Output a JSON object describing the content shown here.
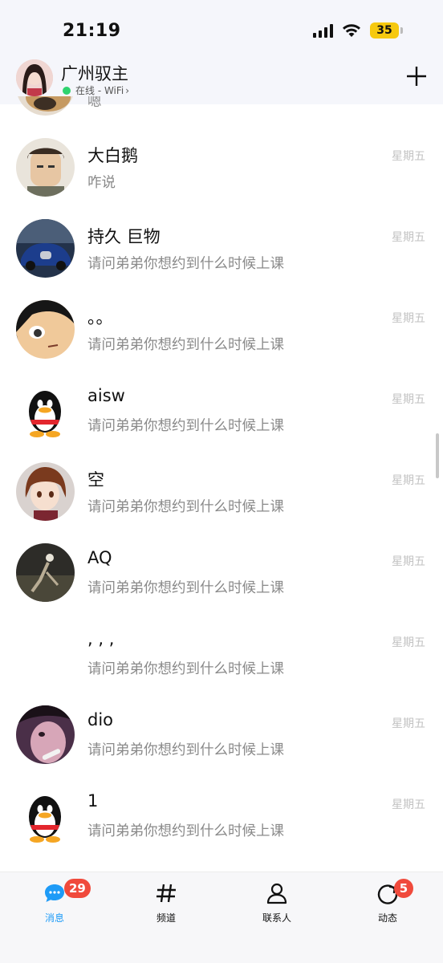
{
  "status_bar": {
    "time": "21:19",
    "battery": "35"
  },
  "header": {
    "name": "广州驭主",
    "status": "在线 - WiFi",
    "status_chevron": "›"
  },
  "conversations": [
    {
      "name": "",
      "message": "嗯",
      "time": ""
    },
    {
      "name": "大白鹅",
      "message": "咋说",
      "time": "星期五"
    },
    {
      "name": "持久 巨物",
      "message": "请问弟弟你想约到什么时候上课",
      "time": "星期五"
    },
    {
      "name": "。。",
      "message": "请问弟弟你想约到什么时候上课",
      "time": "星期五"
    },
    {
      "name": "aisw",
      "message": "请问弟弟你想约到什么时候上课",
      "time": "星期五"
    },
    {
      "name": "空",
      "message": "请问弟弟你想约到什么时候上课",
      "time": "星期五"
    },
    {
      "name": "AQ",
      "message": "请问弟弟你想约到什么时候上课",
      "time": "星期五"
    },
    {
      "name": ", , ,",
      "message": "请问弟弟你想约到什么时候上课",
      "time": "星期五"
    },
    {
      "name": "dio",
      "message": "请问弟弟你想约到什么时候上课",
      "time": "星期五"
    },
    {
      "name": "1",
      "message": "请问弟弟你想约到什么时候上课",
      "time": "星期五"
    }
  ],
  "tabs": [
    {
      "label": "消息",
      "icon": "chat-bubble-icon",
      "badge": "29",
      "active": true
    },
    {
      "label": "频道",
      "icon": "hash-icon",
      "badge": "",
      "active": false
    },
    {
      "label": "联系人",
      "icon": "person-icon",
      "badge": "",
      "active": false
    },
    {
      "label": "动态",
      "icon": "refresh-circle-icon",
      "badge": "5",
      "active": false
    }
  ],
  "colors": {
    "accent": "#1e9bf7",
    "badge": "#f04a3c",
    "online": "#2fd36f",
    "battery": "#f6c90e"
  }
}
